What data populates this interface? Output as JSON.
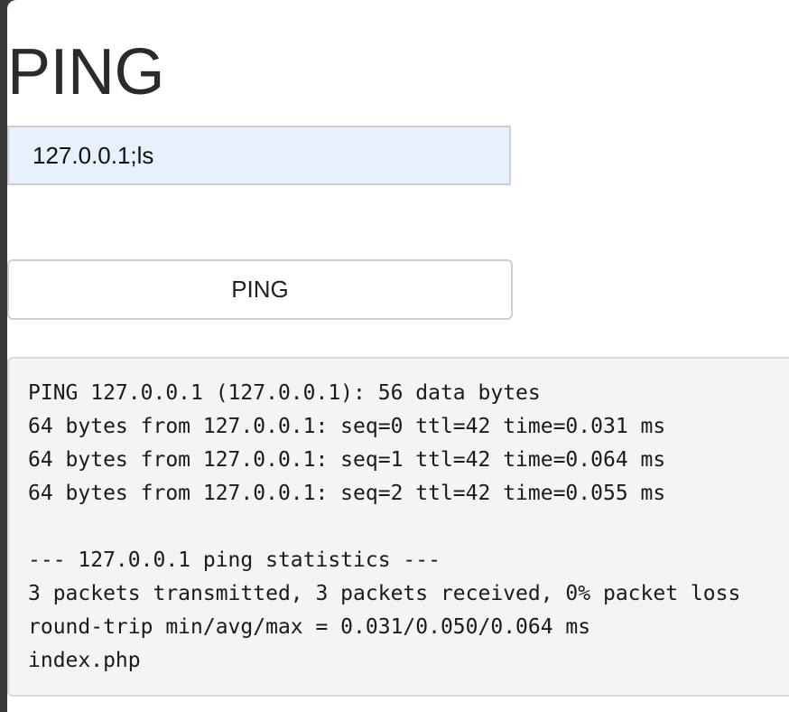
{
  "page": {
    "title": "PING"
  },
  "form": {
    "host_value": "127.0.0.1;ls",
    "submit_label": "PING"
  },
  "output": {
    "lines": [
      "PING 127.0.0.1 (127.0.0.1): 56 data bytes",
      "64 bytes from 127.0.0.1: seq=0 ttl=42 time=0.031 ms",
      "64 bytes from 127.0.0.1: seq=1 ttl=42 time=0.064 ms",
      "64 bytes from 127.0.0.1: seq=2 ttl=42 time=0.055 ms",
      "",
      "--- 127.0.0.1 ping statistics ---",
      "3 packets transmitted, 3 packets received, 0% packet loss",
      "round-trip min/avg/max = 0.031/0.050/0.064 ms",
      "index.php"
    ]
  },
  "colors": {
    "input_autofill_bg": "#e8f0fe",
    "output_bg": "#f4f4f4",
    "window_frame": "#3a3a3a"
  }
}
